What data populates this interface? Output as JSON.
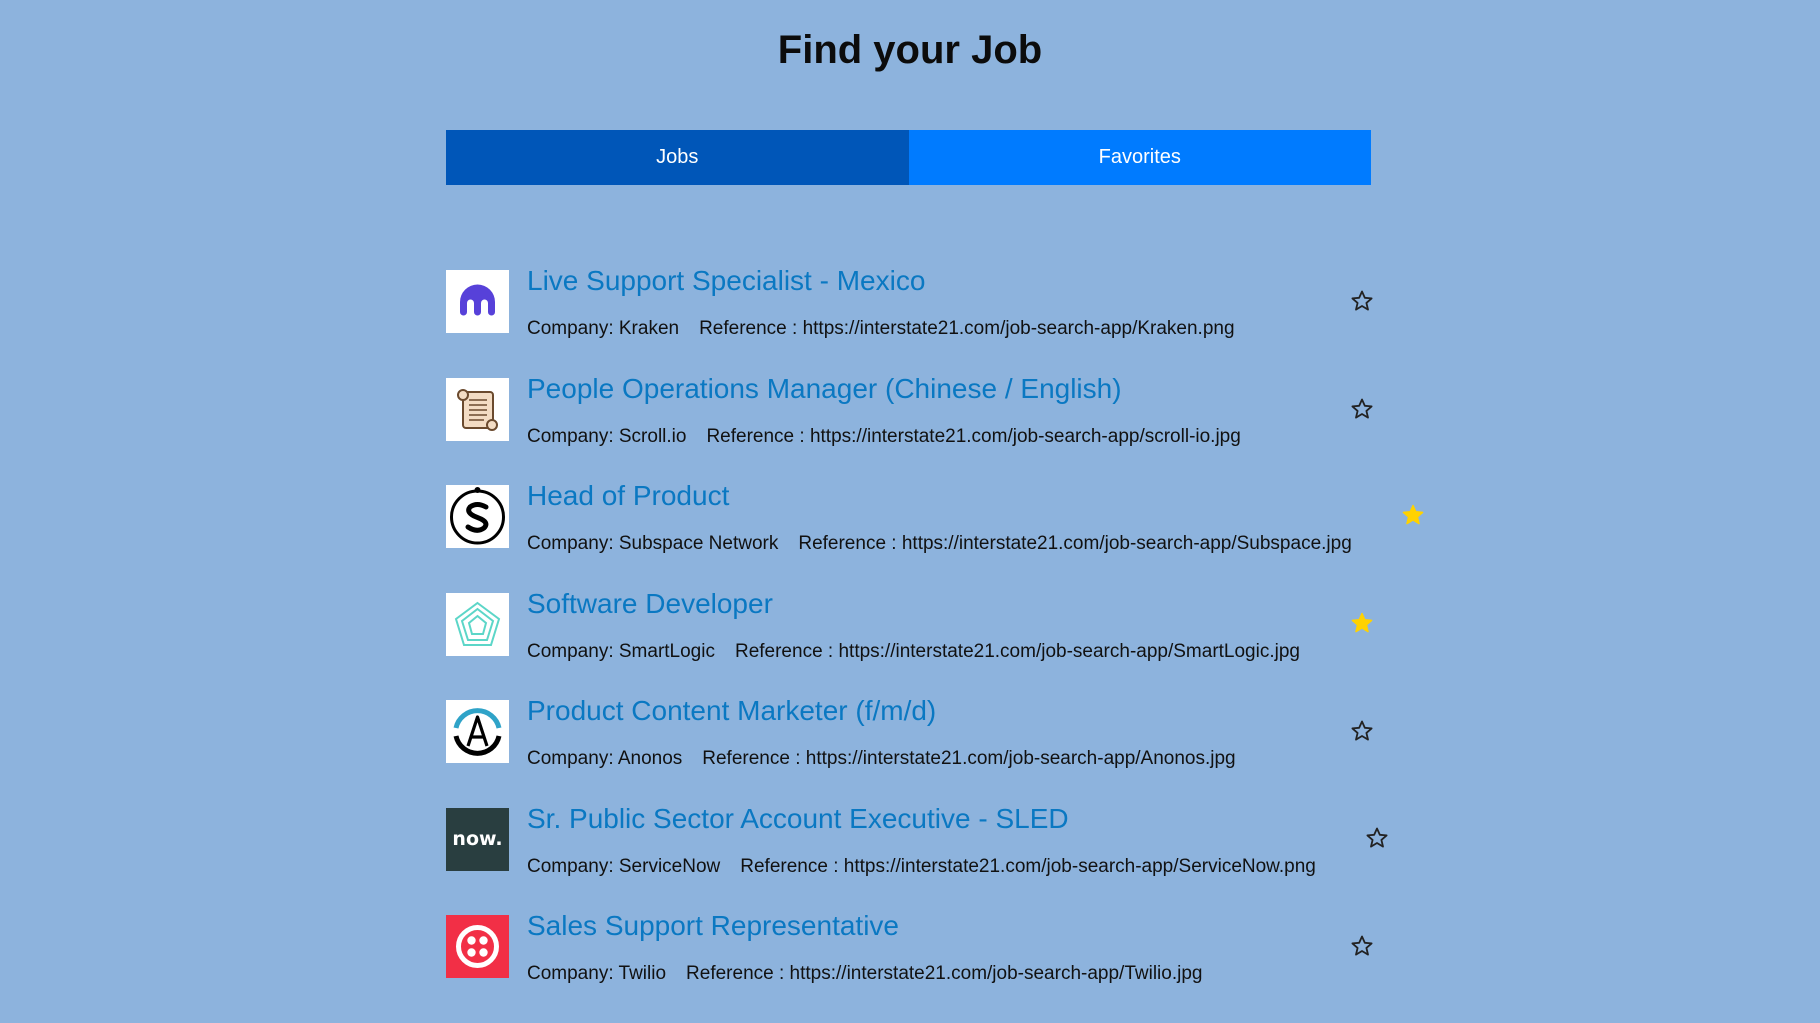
{
  "header": {
    "title": "Find your Job"
  },
  "tabs": [
    {
      "label": "Jobs",
      "active": true
    },
    {
      "label": "Favorites",
      "active": false
    }
  ],
  "colors": {
    "background": "#8db3dd",
    "tab_active": "#0056b8",
    "tab_inactive": "#007bff",
    "job_title": "#0a78c2",
    "favorite_star": "#ffd200"
  },
  "jobs": [
    {
      "title": "Live Support Specialist - Mexico",
      "company": "Company: Kraken",
      "reference": "Reference : https://interstate21.com/job-search-app/Kraken.png",
      "logo_icon": "kraken-logo-icon",
      "favorite": false
    },
    {
      "title": "People Operations Manager (Chinese / English)",
      "company": "Company: Scroll.io",
      "reference": "Reference : https://interstate21.com/job-search-app/scroll-io.jpg",
      "logo_icon": "scroll-logo-icon",
      "favorite": false
    },
    {
      "title": "Head of Product",
      "company": "Company: Subspace Network",
      "reference": "Reference : https://interstate21.com/job-search-app/Subspace.jpg",
      "logo_icon": "subspace-logo-icon",
      "favorite": true
    },
    {
      "title": "Software Developer",
      "company": "Company: SmartLogic",
      "reference": "Reference : https://interstate21.com/job-search-app/SmartLogic.jpg",
      "logo_icon": "smartlogic-logo-icon",
      "favorite": true
    },
    {
      "title": "Product Content Marketer (f/m/d)",
      "company": "Company: Anonos",
      "reference": "Reference : https://interstate21.com/job-search-app/Anonos.jpg",
      "logo_icon": "anonos-logo-icon",
      "favorite": false
    },
    {
      "title": "Sr. Public Sector Account Executive - SLED",
      "company": "Company: ServiceNow",
      "reference": "Reference : https://interstate21.com/job-search-app/ServiceNow.png",
      "logo_icon": "servicenow-logo-icon",
      "logo_text": "now.",
      "favorite": false
    },
    {
      "title": "Sales Support Representative",
      "company": "Company: Twilio",
      "reference": "Reference : https://interstate21.com/job-search-app/Twilio.jpg",
      "logo_icon": "twilio-logo-icon",
      "favorite": false
    }
  ]
}
